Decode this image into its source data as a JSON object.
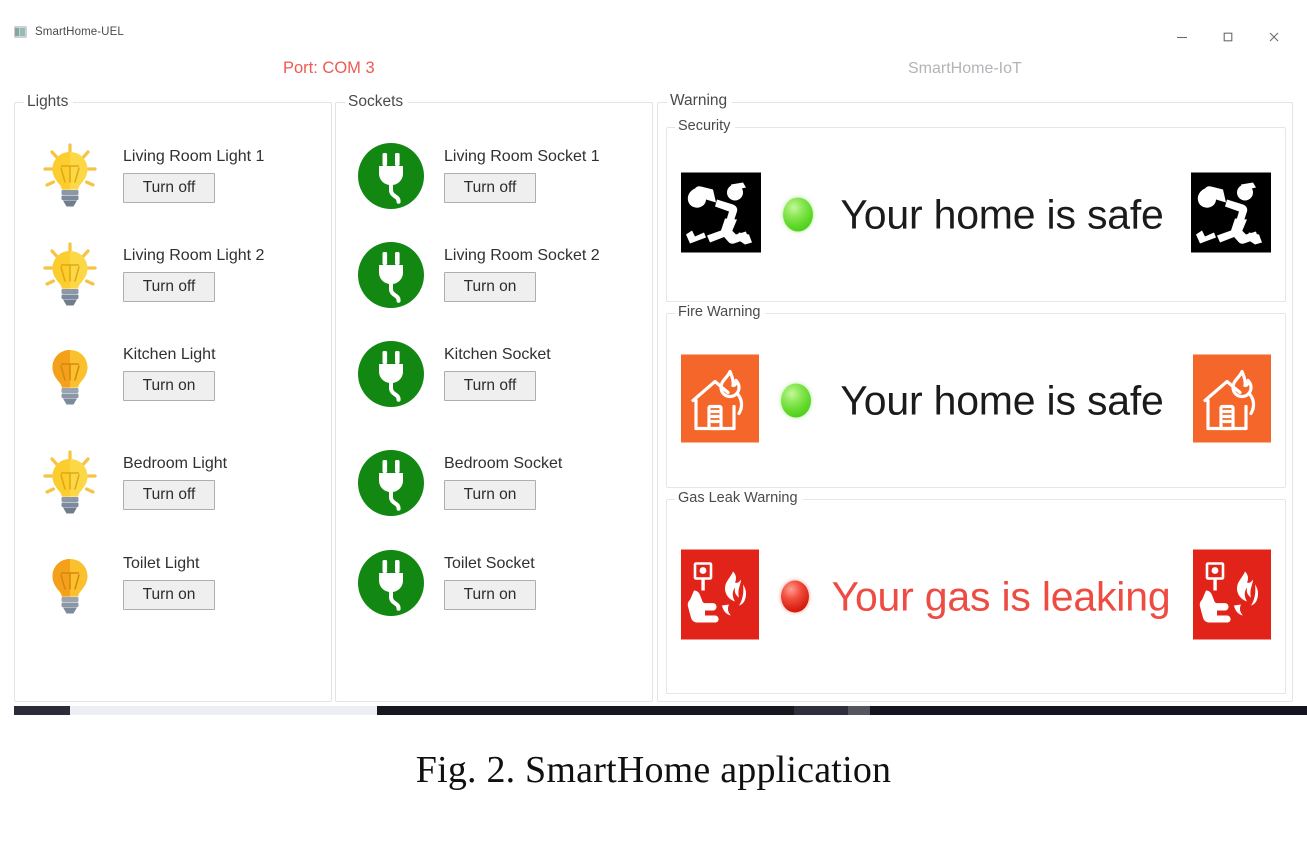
{
  "window": {
    "title": "SmartHome-UEL",
    "icon": "app-icon",
    "controls": {
      "minimize": "minimize-icon",
      "maximize": "maximize-icon",
      "close": "close-icon"
    }
  },
  "header": {
    "port_label": "Port: COM 3",
    "port_color": "#ee5a52",
    "app_subtitle": "SmartHome-IoT",
    "subtitle_color": "#b4b4b8"
  },
  "lights_panel": {
    "title": "Lights",
    "items": [
      {
        "name": "Living Room Light 1",
        "button": "Turn off",
        "state": "on",
        "icon": "light-bulb-on-icon"
      },
      {
        "name": "Living Room Light 2",
        "button": "Turn off",
        "state": "on",
        "icon": "light-bulb-on-icon"
      },
      {
        "name": "Kitchen Light",
        "button": "Turn on",
        "state": "off",
        "icon": "light-bulb-off-icon"
      },
      {
        "name": "Bedroom Light",
        "button": "Turn off",
        "state": "on",
        "icon": "light-bulb-on-icon"
      },
      {
        "name": "Toilet Light",
        "button": "Turn on",
        "state": "off",
        "icon": "light-bulb-off-icon"
      }
    ]
  },
  "sockets_panel": {
    "title": "Sockets",
    "items": [
      {
        "name": "Living Room Socket 1",
        "button": "Turn off",
        "state": "on",
        "icon": "power-plug-icon"
      },
      {
        "name": "Living Room Socket 2",
        "button": "Turn on",
        "state": "off",
        "icon": "power-plug-icon"
      },
      {
        "name": "Kitchen Socket",
        "button": "Turn off",
        "state": "on",
        "icon": "power-plug-icon"
      },
      {
        "name": "Bedroom Socket",
        "button": "Turn on",
        "state": "off",
        "icon": "power-plug-icon"
      },
      {
        "name": "Toilet Socket",
        "button": "Turn on",
        "state": "off",
        "icon": "power-plug-icon"
      }
    ]
  },
  "warning_panel": {
    "title": "Warning",
    "sections": [
      {
        "title": "Security",
        "status_text": "Your home is safe",
        "status": "safe",
        "led_color": "#5ed927",
        "icon": "burglar-icon",
        "icon_bg": "#000000"
      },
      {
        "title": "Fire Warning",
        "status_text": "Your home is safe",
        "status": "safe",
        "led_color": "#5ed927",
        "icon": "house-fire-icon",
        "icon_bg": "#f4662a"
      },
      {
        "title": "Gas Leak Warning",
        "status_text": "Your gas is leaking",
        "status": "alarm",
        "led_color": "#d81f10",
        "text_color": "#ee4b42",
        "icon": "fire-alarm-call-point-icon",
        "icon_bg": "#e2231a"
      }
    ]
  },
  "caption": "Fig. 2. SmartHome application",
  "colors": {
    "socket_green": "#128712",
    "bulb_on_yellow": "#fcd846",
    "bulb_off_orange": "#f5a623",
    "button_face": "#efefef",
    "button_border": "#adadb2",
    "groupbox_border": "#e3e3e8"
  }
}
